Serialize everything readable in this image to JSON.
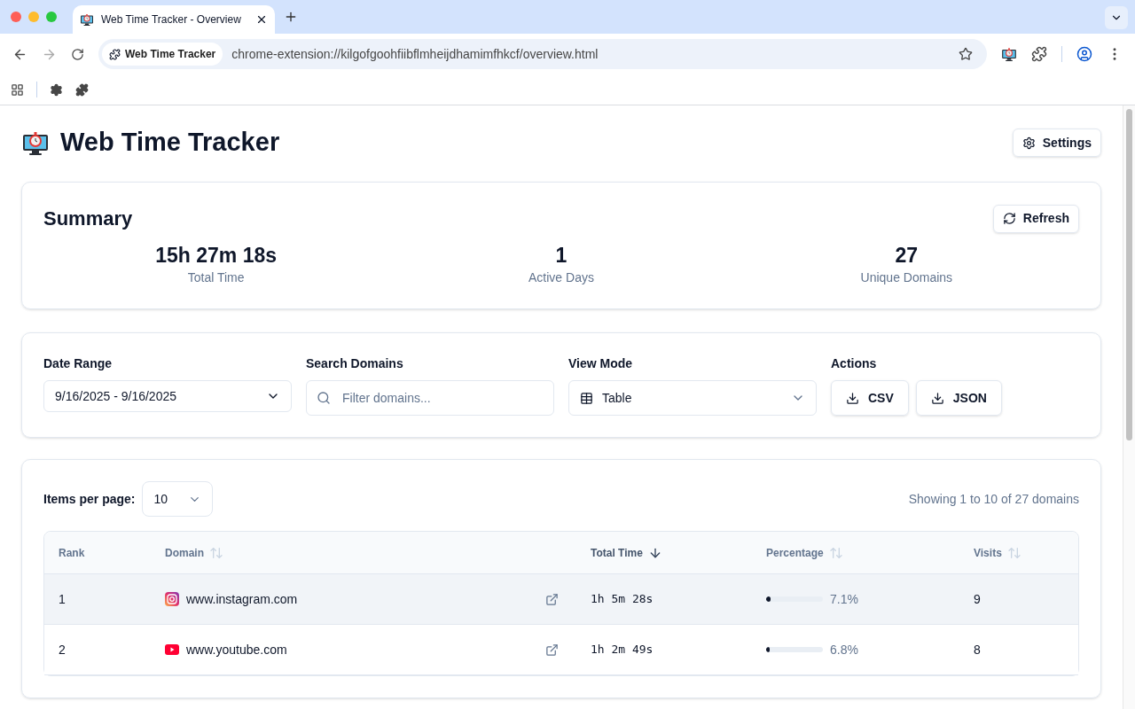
{
  "browser": {
    "tab_title": "Web Time Tracker - Overview",
    "site_chip": "Web Time Tracker",
    "url": "chrome-extension://kilgofgoohfiibflmheijdhamimfhkcf/overview.html"
  },
  "header": {
    "title": "Web Time Tracker",
    "settings_button": "Settings"
  },
  "summary": {
    "title": "Summary",
    "refresh_button": "Refresh",
    "stats": [
      {
        "value": "15h 27m 18s",
        "label": "Total Time"
      },
      {
        "value": "1",
        "label": "Active Days"
      },
      {
        "value": "27",
        "label": "Unique Domains"
      }
    ]
  },
  "filters": {
    "date_range": {
      "label": "Date Range",
      "value": "9/16/2025 - 9/16/2025"
    },
    "search": {
      "label": "Search Domains",
      "placeholder": "Filter domains..."
    },
    "view_mode": {
      "label": "View Mode",
      "value": "Table"
    },
    "actions": {
      "label": "Actions",
      "buttons": [
        "CSV",
        "JSON"
      ]
    }
  },
  "table": {
    "items_per_page_label": "Items per page:",
    "items_per_page": "10",
    "showing": "Showing 1 to 10 of 27 domains",
    "columns": [
      {
        "label": "Rank",
        "sortable": false,
        "sorted_descending": false
      },
      {
        "label": "Domain",
        "sortable": true,
        "sorted_descending": false
      },
      {
        "label": "Total Time",
        "sortable": true,
        "sorted_descending": true
      },
      {
        "label": "Percentage",
        "sortable": true,
        "sorted_descending": false
      },
      {
        "label": "Visits",
        "sortable": true,
        "sorted_descending": false
      }
    ],
    "rows": [
      {
        "rank": "1",
        "domain": "www.instagram.com",
        "total_time": "1h 5m 28s",
        "percentage": "7.1%",
        "level": 0.071,
        "visits": "9",
        "highlighted": true
      },
      {
        "rank": "2",
        "domain": "www.youtube.com",
        "total_time": "1h 2m 49s",
        "percentage": "6.8%",
        "level": 0.068,
        "visits": "8",
        "highlighted": false
      }
    ]
  }
}
